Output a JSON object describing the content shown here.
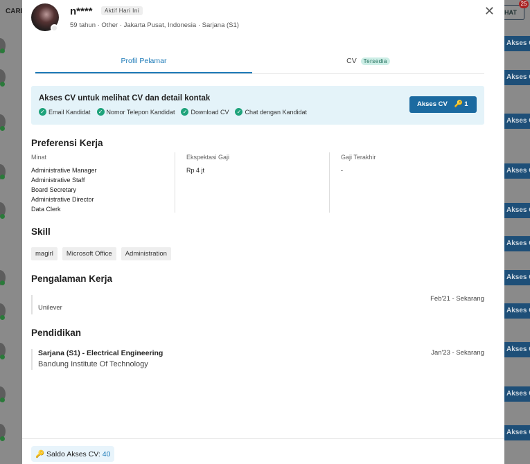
{
  "background": {
    "search_label": "CARI",
    "chat_label": "HAT",
    "chat_badge": "25",
    "akses_button_label": "Akses C"
  },
  "candidate": {
    "name": "n****",
    "status_badge": "Aktif Hari Ini",
    "meta": "59 tahun · Other · Jakarta Pusat, Indonesia · Sarjana (S1)"
  },
  "tabs": {
    "profile": "Profil Pelamar",
    "cv": "CV",
    "cv_tag": "Tersedia"
  },
  "cv_access": {
    "title": "Akses CV untuk melihat CV dan detail kontak",
    "features": [
      "Email Kandidat",
      "Nomor Telepon Kandidat",
      "Download CV",
      "Chat dengan Kandidat"
    ],
    "button_label": "Akses CV",
    "button_count": "1"
  },
  "preferences": {
    "title": "Preferensi Kerja",
    "interest_label": "Minat",
    "interests": [
      "Administrative Manager",
      "Administrative Staff",
      "Board Secretary",
      "Administrative Director",
      "Data Clerk"
    ],
    "expected_salary_label": "Ekspektasi Gaji",
    "expected_salary": "Rp 4 jt",
    "last_salary_label": "Gaji Terakhir",
    "last_salary": "-"
  },
  "skills": {
    "title": "Skill",
    "items": [
      "magirl",
      "Microsoft Office",
      "Administration"
    ]
  },
  "experience": {
    "title": "Pengalaman Kerja",
    "items": [
      {
        "company": "Unilever",
        "period": "Feb'21 - Sekarang"
      }
    ]
  },
  "education": {
    "title": "Pendidikan",
    "items": [
      {
        "degree": "Sarjana (S1) - Electrical Engineering",
        "school": "Bandung Institute Of Technology",
        "period": "Jan'23 - Sekarang"
      }
    ]
  },
  "footer": {
    "saldo_label": "Saldo Akses CV:",
    "saldo_value": "40"
  },
  "colors": {
    "accent": "#1e7bb8",
    "button": "#1b6aa0",
    "check": "#1fa37b",
    "banner": "#e4f3f9"
  }
}
